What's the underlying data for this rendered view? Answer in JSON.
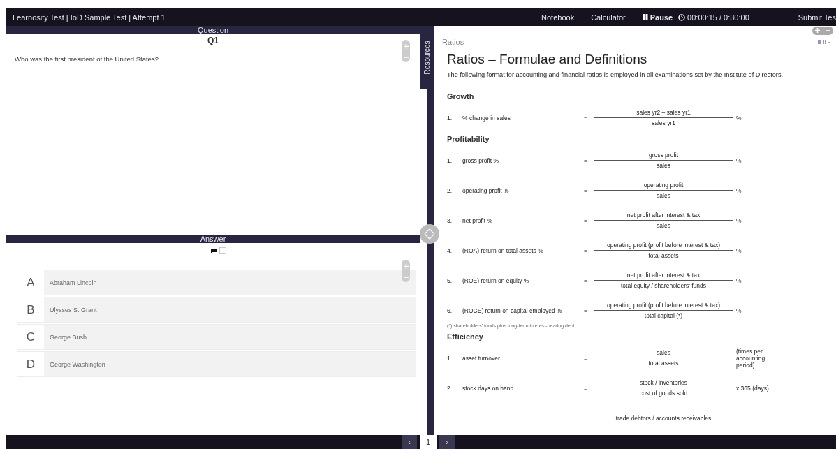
{
  "header": {
    "title": "Learnosity Test | IoD Sample Test | Attempt 1",
    "tools": [
      {
        "kind": "link",
        "label": "Notebook"
      },
      {
        "kind": "link",
        "label": "Calculator"
      },
      {
        "kind": "pause",
        "label": "Pause"
      },
      {
        "kind": "timer",
        "label": "00:00:15 / 0:30:00"
      }
    ],
    "submit": "Submit Tes"
  },
  "question": {
    "header": "Question",
    "number": "Q1",
    "text": "Who was the first president of the United States?"
  },
  "answer": {
    "header": "Answer",
    "flag_checked": false,
    "choices": [
      {
        "letter": "A",
        "text": "Abraham Lincoln",
        "selected": false
      },
      {
        "letter": "B",
        "text": "Ulysses S. Grant",
        "selected": false
      },
      {
        "letter": "C",
        "text": "George Bush",
        "selected": false
      },
      {
        "letter": "D",
        "text": "George Washington",
        "selected": false
      }
    ]
  },
  "resources": {
    "tab": "Resources",
    "title": "Ratios",
    "heading": "Ratios – Formulae and Definitions",
    "intro": "The following format for accounting and financial ratios is employed in all examinations set by the Institute of Directors.",
    "sections": [
      {
        "title": "Growth",
        "rows": [
          {
            "number": "1.",
            "label": "% change in sales",
            "equals": "=",
            "numerator": "sales yr2 – sales yr1",
            "denominator": "sales yr1",
            "suffix": "%"
          }
        ]
      },
      {
        "title": "Profitability",
        "rows": [
          {
            "number": "1.",
            "label": "gross profit %",
            "equals": "=",
            "numerator": "gross profit",
            "denominator": "sales",
            "suffix": "%"
          },
          {
            "number": "2.",
            "label": "operating profit %",
            "equals": "=",
            "numerator": "operating profit",
            "denominator": "sales",
            "suffix": "%"
          },
          {
            "number": "3.",
            "label": "net profit %",
            "equals": "=",
            "numerator": "net profit after interest & tax",
            "denominator": "sales",
            "suffix": "%"
          },
          {
            "number": "4.",
            "label": "(ROA) return on total assets %",
            "equals": "=",
            "numerator": "operating profit (profit before interest & tax)",
            "denominator": "total assets",
            "suffix": "%"
          },
          {
            "number": "5.",
            "label": "(ROE) return on equity %",
            "equals": "=",
            "numerator": "net profit after interest & tax",
            "denominator": "total equity / shareholders’ funds",
            "suffix": "%"
          },
          {
            "number": "6.",
            "label": "(ROCE) return on capital employed %",
            "equals": "=",
            "numerator": "operating profit (profit before interest & tax)",
            "denominator": "total capital (*)",
            "suffix": "%"
          }
        ],
        "footnote": "(*) shareholders’ funds plus long-term interest-bearing debt"
      },
      {
        "title": "Efficiency",
        "rows": [
          {
            "number": "1.",
            "label": "asset turnover",
            "equals": "=",
            "numerator": "sales",
            "denominator": "total assets",
            "suffix": "(times per accounting period)"
          },
          {
            "number": "2.",
            "label": "stock days on hand",
            "equals": "=",
            "numerator": "stock / inventories",
            "denominator": "cost of goods sold",
            "suffix": "x 365 (days)"
          }
        ],
        "partial_numerator": "trade debtors / accounts receivables"
      }
    ]
  },
  "pagination": {
    "prev": "‹",
    "page": "1",
    "next": "›"
  }
}
